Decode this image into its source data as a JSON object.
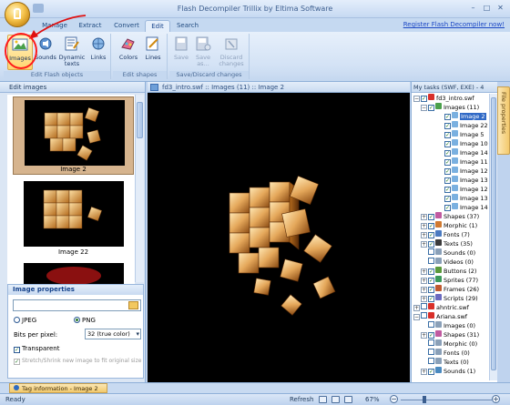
{
  "window": {
    "title": "Flash Decompiler Trillix by Eltima Software"
  },
  "tabs": [
    {
      "label": "Manage"
    },
    {
      "label": "Extract"
    },
    {
      "label": "Convert"
    },
    {
      "label": "Edit"
    },
    {
      "label": "Search"
    }
  ],
  "register_link": "Register Flash Decompiler now!",
  "ribbon": {
    "edit_flash_objects": {
      "label": "Edit Flash objects",
      "buttons": [
        "Images",
        "Sounds",
        "Dynamic texts",
        "Links"
      ]
    },
    "edit_shapes": {
      "label": "Edit shapes",
      "buttons": [
        "Colors",
        "Lines"
      ]
    },
    "save_discard": {
      "label": "Save/Discard changes",
      "buttons": [
        "Save",
        "Save as...",
        "Discard changes"
      ]
    }
  },
  "left_panel": {
    "title": "Edit images",
    "thumbnails": [
      {
        "caption": "Image 2"
      },
      {
        "caption": "Image 22"
      }
    ]
  },
  "image_properties": {
    "title": "Image properties",
    "file_path": "",
    "format_jpeg": "JPEG",
    "format_png": "PNG",
    "format_selected": "PNG",
    "bits_label": "Bits per pixel:",
    "bits_value": "32 (true color)",
    "transparent_label": "Transparent",
    "transparent_checked": true,
    "stretch_label": "Stretch/Shrink new image to fit original size",
    "stretch_checked": true
  },
  "document": {
    "breadcrumb": "fd3_intro.swf :: Images (11) :: Image 2"
  },
  "tasks": {
    "title": "My tasks (SWF, EXE) - 4",
    "side_tab": "File properties",
    "nodes": [
      {
        "label": "fd3_intro.swf"
      },
      {
        "label": "Images (11)"
      },
      {
        "label": "Image 2"
      },
      {
        "label": "Image 22"
      },
      {
        "label": "Image 5"
      },
      {
        "label": "Image 10"
      },
      {
        "label": "Image 14"
      },
      {
        "label": "Image 11"
      },
      {
        "label": "Image 12"
      },
      {
        "label": "Image 13"
      },
      {
        "label": "Image 12"
      },
      {
        "label": "Image 13"
      },
      {
        "label": "Image 14"
      },
      {
        "label": "Shapes (37)"
      },
      {
        "label": "Morphic (1)"
      },
      {
        "label": "Fonts (7)"
      },
      {
        "label": "Texts (35)"
      },
      {
        "label": "Sounds (0)"
      },
      {
        "label": "Videos (0)"
      },
      {
        "label": "Buttons (2)"
      },
      {
        "label": "Sprites (77)"
      },
      {
        "label": "Frames (26)"
      },
      {
        "label": "Scripts (29)"
      },
      {
        "label": "ahntric.swf"
      },
      {
        "label": "Ariana.swf"
      },
      {
        "label": "Images (0)"
      },
      {
        "label": "Shapes (31)"
      },
      {
        "label": "Morphic (0)"
      },
      {
        "label": "Fonts (0)"
      },
      {
        "label": "Texts (0)"
      },
      {
        "label": "Sounds (1)"
      }
    ]
  },
  "bottom_tab": "Tag information - Image 2",
  "status": {
    "text": "Ready",
    "refresh": "Refresh",
    "zoom": "67%"
  }
}
